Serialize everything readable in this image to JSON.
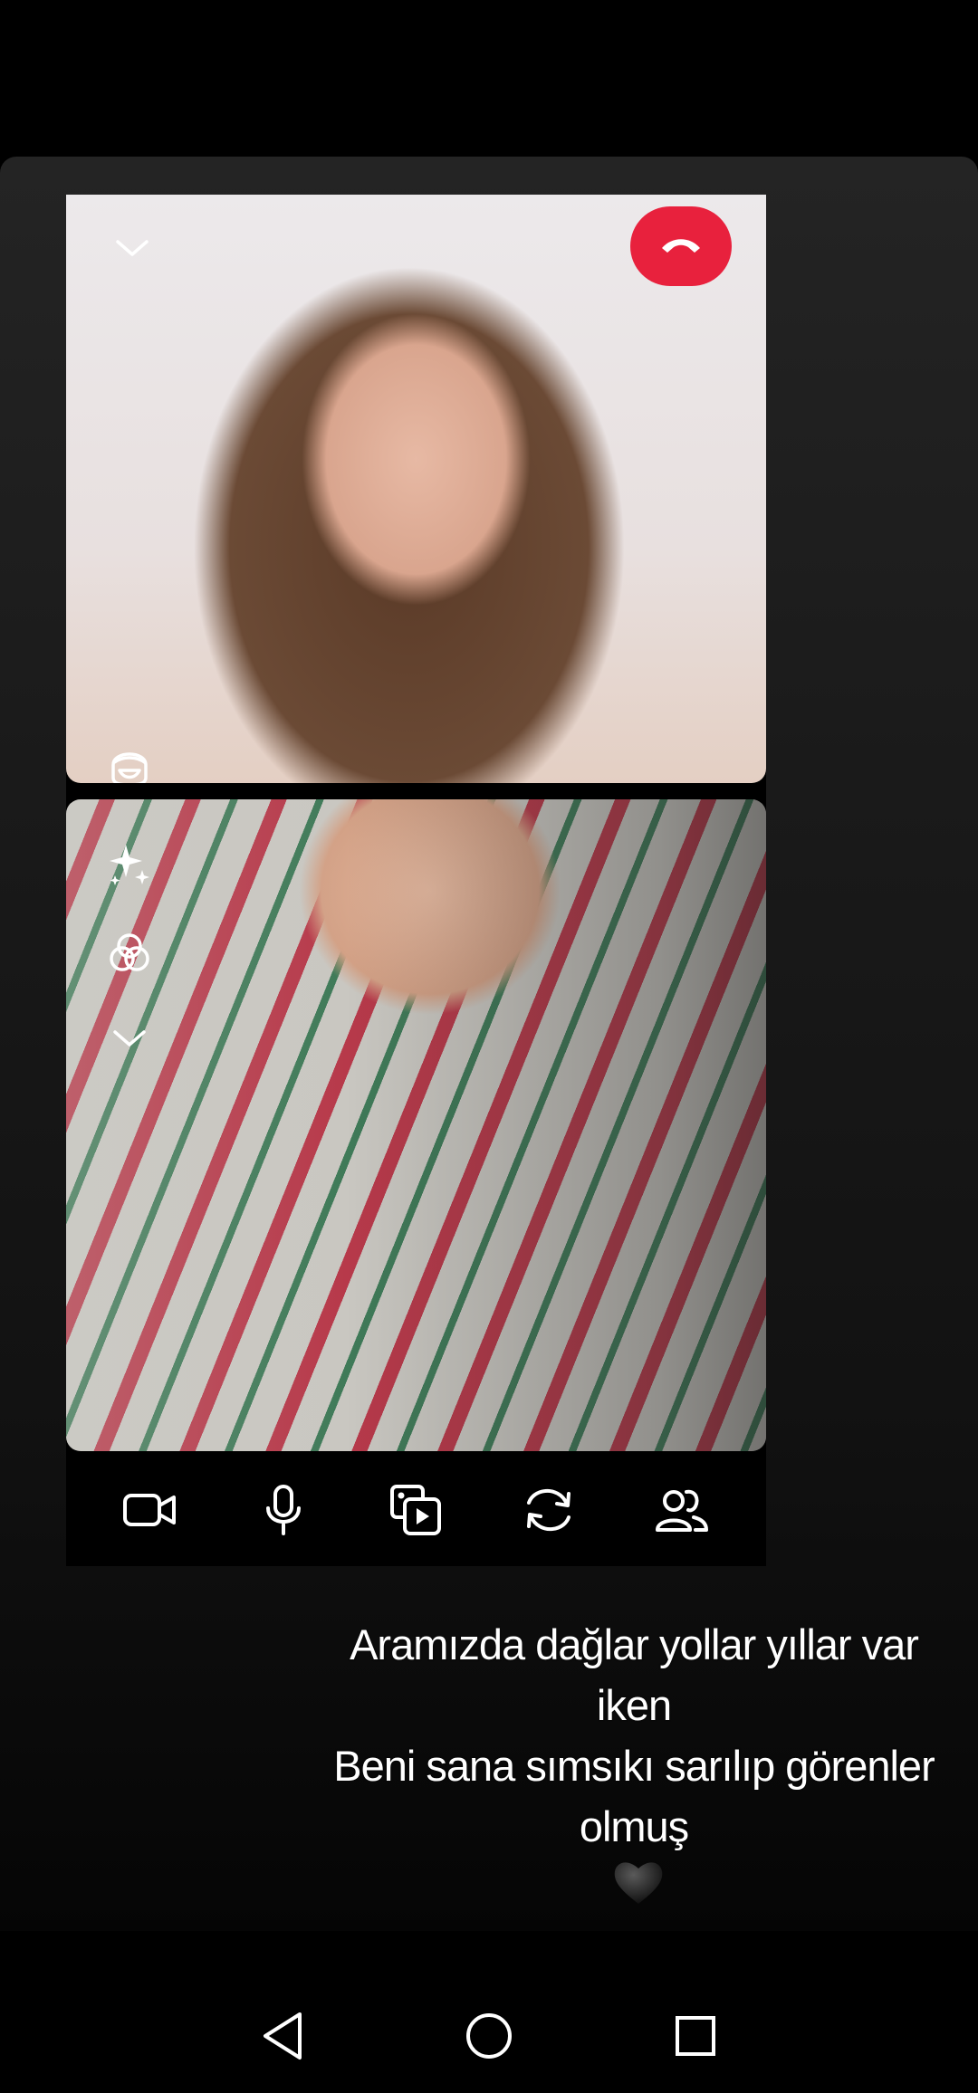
{
  "caption": {
    "line1": "Aramızda dağlar yollar yıllar var",
    "line2": "iken",
    "line3": "Beni sana sımsıkı sarılıp görenler",
    "line4": "olmuş"
  },
  "icons": {
    "remote_collapse": "chevron-down-icon",
    "end_call": "phone-hangup-icon",
    "filter": "face-filter-icon",
    "sparkle": "sparkle-icon",
    "effects": "overlapping-circles-icon",
    "self_collapse": "chevron-down-icon",
    "heart": "black-heart-icon",
    "toolbar": [
      "video-camera-icon",
      "microphone-icon",
      "media-share-icon",
      "flip-camera-icon",
      "add-people-icon"
    ],
    "nav": [
      "back-triangle-icon",
      "home-circle-icon",
      "recents-square-icon"
    ]
  },
  "colors": {
    "end_call": "#e8213d",
    "icon": "#ffffff",
    "background": "#000000"
  }
}
